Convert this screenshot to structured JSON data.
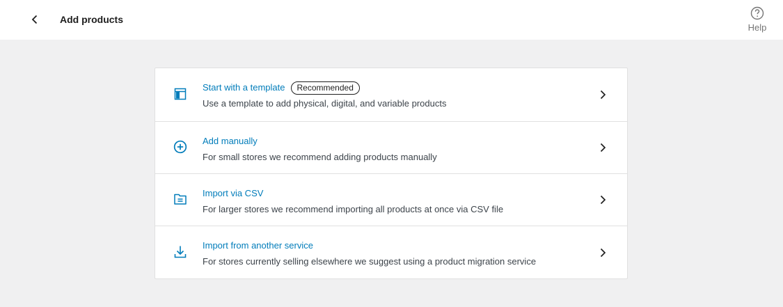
{
  "header": {
    "title": "Add products",
    "back_icon": "chevron-left-icon",
    "help_label": "Help",
    "help_icon": "help-circle-icon"
  },
  "options": [
    {
      "title": "Start with a template",
      "badge": "Recommended",
      "description": "Use a template to add physical, digital, and variable products",
      "icon": "template-layout-icon"
    },
    {
      "title": "Add manually",
      "description": "For small stores we recommend adding products manually",
      "icon": "plus-circle-icon"
    },
    {
      "title": "Import via CSV",
      "description": "For larger stores we recommend importing all products at once via CSV file",
      "icon": "file-icon"
    },
    {
      "title": "Import from another service",
      "description": "For stores currently selling elsewhere we suggest using a product migration service",
      "icon": "download-icon"
    }
  ],
  "colors": {
    "accent": "#007cba",
    "background": "#f0f0f1",
    "text": "#1e1e1e",
    "muted": "#757575"
  }
}
